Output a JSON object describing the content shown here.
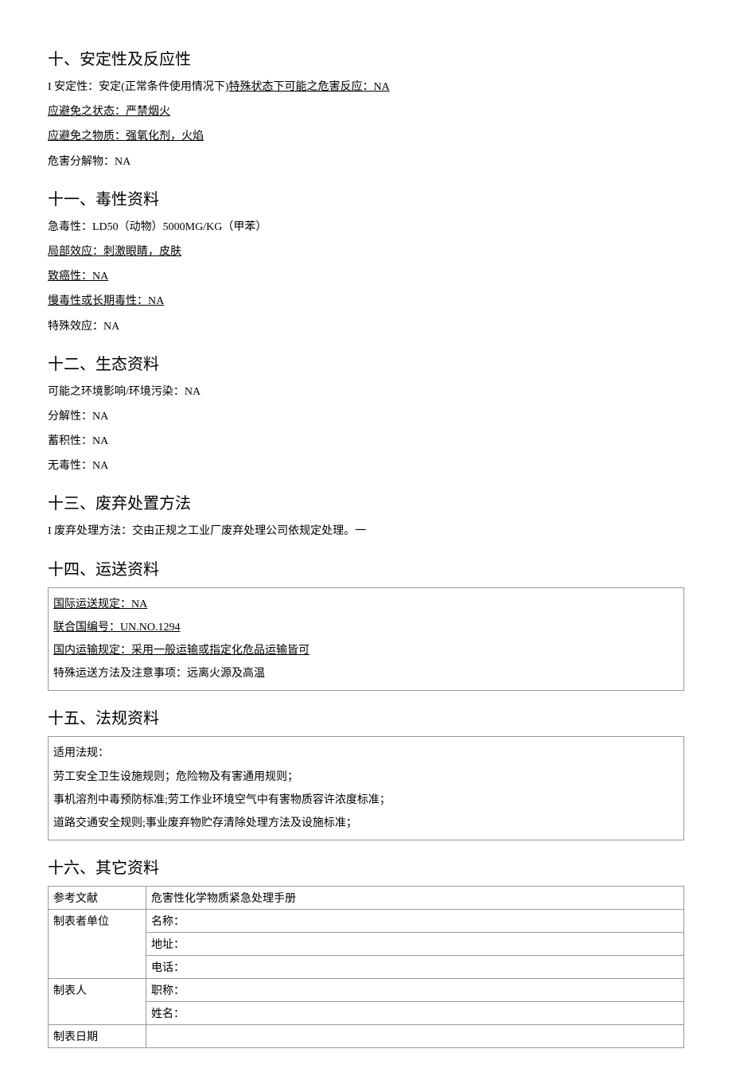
{
  "s10": {
    "heading": "十、安定性及反应性",
    "line1_prefix": "I 安定性：安定(正常条件使用情况下)",
    "line1_under": "特殊状态下可能之危害反应：NA",
    "line2": "应避免之状态：严禁烟火",
    "line3": "应避免之物质：强氧化剂，火焰",
    "line4": "危害分解物：NA"
  },
  "s11": {
    "heading": "十一、毒性资料",
    "line1": "急毒性：LD50（动物）5000MG/KG（甲苯）",
    "line2": "局部效应：刺激眼睛，皮肤",
    "line3": "致癌性：NA",
    "line4": "慢毒性或长期毒性：NA",
    "line5": "特殊效应：NA"
  },
  "s12": {
    "heading": "十二、生态资料",
    "line1": "可能之环境影响/环境污染：NA",
    "line2": "分解性：NA",
    "line3": "蓄积性：NA",
    "line4": "无毒性：NA"
  },
  "s13": {
    "heading": "十三、废弃处置方法",
    "line1": "I 废弃处理方法：交由正规之工业厂废弃处理公司依规定处理。一"
  },
  "s14": {
    "heading": "十四、运送资料",
    "line1": "国际运送规定：NA",
    "line2": "联合国编号：UN.NO.1294",
    "line3": "国内运输规定：采用一般运输或指定化危品运输皆可",
    "line4": "特殊运送方法及注意事项：远离火源及高温"
  },
  "s15": {
    "heading": "十五、法规资料",
    "line1": "适用法规：",
    "line2": "劳工安全卫生设施规则；危险物及有害通用规则；",
    "line3": "事机溶剂中毒预防标准;劳工作业环境空气中有害物质容许浓度标准；",
    "line4": "道路交通安全规则;事业废弃物贮存清除处理方法及设施标准；"
  },
  "s16": {
    "heading": "十六、其它资料",
    "rows": {
      "ref_label": "参考文献",
      "ref_value": "危害性化学物质紧急处理手册",
      "maker_unit_label": "制表者单位",
      "name_label": "名称：",
      "addr_label": "地址：",
      "tel_label": "电话：",
      "maker_label": "制表人",
      "title_label": "职称：",
      "person_name_label": "姓名：",
      "date_label": "制表日期"
    }
  }
}
